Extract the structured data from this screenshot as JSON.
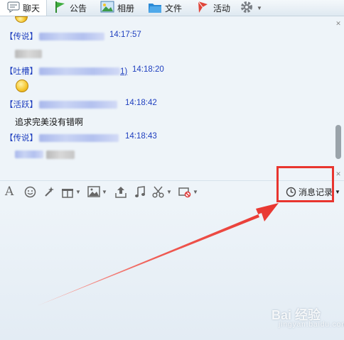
{
  "tabs": [
    {
      "label": "聊天",
      "icon": "chat-bubble-icon"
    },
    {
      "label": "公告",
      "icon": "flag-icon"
    },
    {
      "label": "相册",
      "icon": "photo-icon"
    },
    {
      "label": "文件",
      "icon": "folder-icon"
    },
    {
      "label": "活动",
      "icon": "pin-icon"
    }
  ],
  "messages": [
    {
      "tag": "【传说】",
      "link": "",
      "time": "14:17:57",
      "text": ""
    },
    {
      "tag": "【吐槽】",
      "link": "1)",
      "time": "14:18:20",
      "text": ""
    },
    {
      "tag": "【活跃】",
      "link": "",
      "time": "14:18:42",
      "text": "追求完美没有错啊"
    },
    {
      "tag": "【传说】",
      "link": "",
      "time": "14:18:43",
      "text": ""
    }
  ],
  "toolbar": {
    "history_label": "消息记录"
  },
  "watermark": {
    "brand": "Bai 经验",
    "sub": "jingyan.baidu.com"
  },
  "colors": {
    "accent": "#1f3fbf",
    "highlight": "#e8352f"
  }
}
